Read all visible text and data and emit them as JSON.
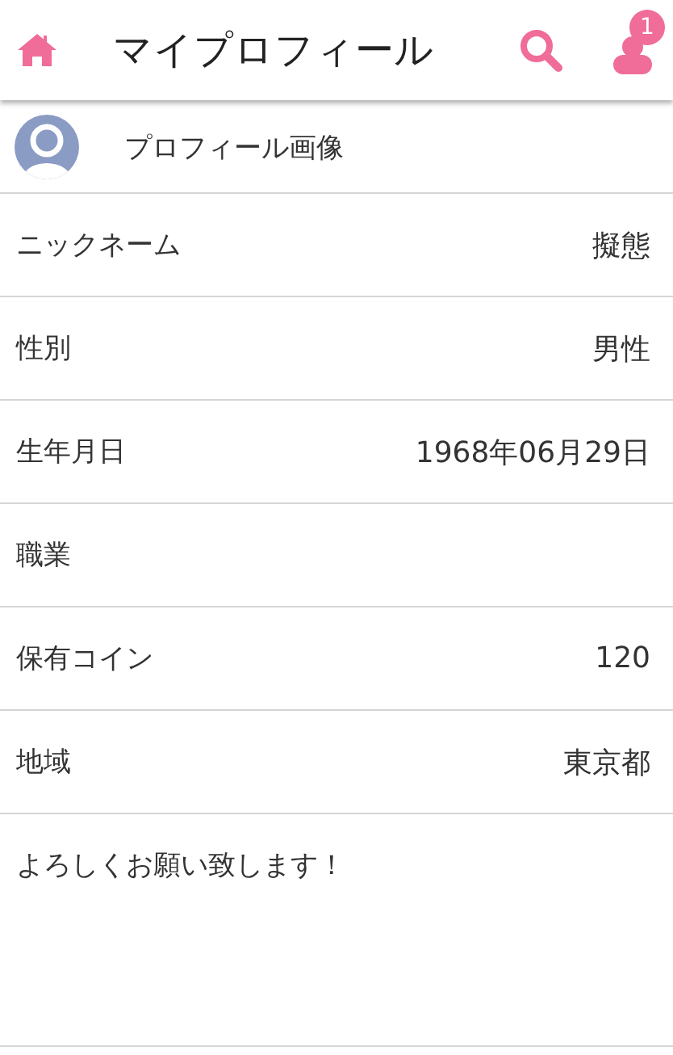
{
  "header": {
    "title": "マイプロフィール",
    "notification_count": "1"
  },
  "profile_image": {
    "label": "プロフィール画像"
  },
  "fields": [
    {
      "label": "ニックネーム",
      "value": "擬態"
    },
    {
      "label": "性別",
      "value": "男性"
    },
    {
      "label": "生年月日",
      "value": "1968年06月29日"
    },
    {
      "label": "職業"
    },
    {
      "label": "保有コイン",
      "value": "120"
    },
    {
      "label": "地域",
      "value": "東京都"
    }
  ],
  "bio": "よろしくお願い致します！"
}
